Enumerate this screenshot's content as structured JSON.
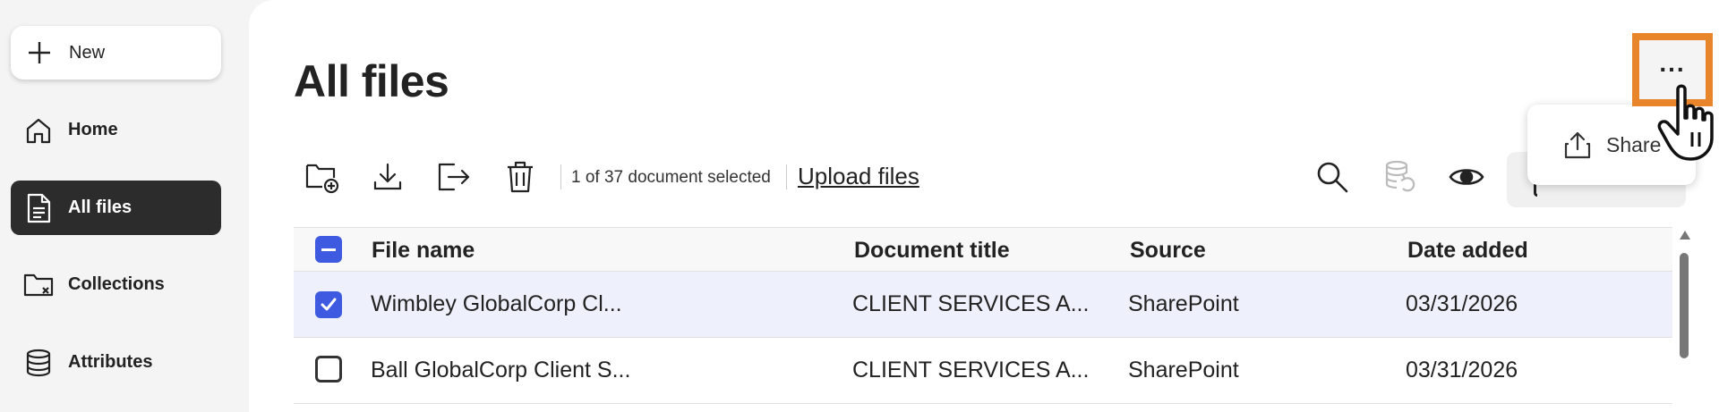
{
  "sidebar": {
    "new_label": "New",
    "items": [
      {
        "label": "Home",
        "icon": "home-icon",
        "active": false
      },
      {
        "label": "All files",
        "icon": "document-icon",
        "active": true
      },
      {
        "label": "Collections",
        "icon": "folder-collection-icon",
        "active": false
      },
      {
        "label": "Attributes",
        "icon": "database-icon",
        "active": false
      }
    ]
  },
  "header": {
    "title": "All files",
    "more_label": "...",
    "share_menu_label": "Share"
  },
  "toolbar": {
    "selected_text": "1 of 37 document selected",
    "upload_label": "Upload files"
  },
  "table": {
    "columns": [
      "File name",
      "Document title",
      "Source",
      "Date added"
    ],
    "rows": [
      {
        "file_name": "Wimbley GlobalCorp Cl...",
        "document_title": "CLIENT SERVICES A...",
        "source": "SharePoint",
        "date_added": "03/31/2026",
        "checked": true
      },
      {
        "file_name": "Ball GlobalCorp Client S...",
        "document_title": "CLIENT SERVICES A...",
        "source": "SharePoint",
        "date_added": "03/31/2026",
        "checked": false
      }
    ]
  },
  "colors": {
    "accent": "#3d5ae0",
    "highlight": "#e8852b",
    "active_nav": "#2c2c2c",
    "selected_row": "#eef0fb"
  }
}
